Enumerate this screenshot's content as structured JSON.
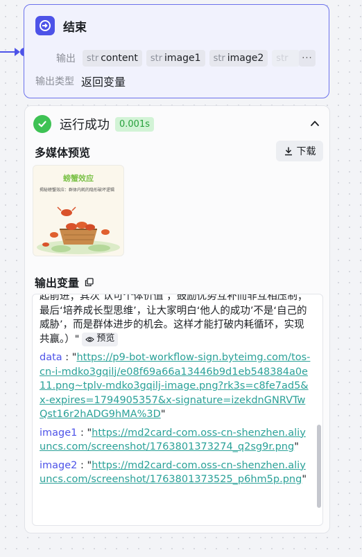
{
  "end_node": {
    "title": "结束",
    "output_label": "输出",
    "outputs": [
      {
        "type": "str",
        "name": "content"
      },
      {
        "type": "str",
        "name": "image1"
      },
      {
        "type": "str",
        "name": "image2"
      },
      {
        "type": "str",
        "name": ""
      }
    ],
    "more_label": "···",
    "output_type_label": "输出类型",
    "output_type_value": "返回变量"
  },
  "result": {
    "status_title": "运行成功",
    "elapsed": "0.001s",
    "media_preview_title": "多媒体预览",
    "download_label": "下载",
    "thumbnail": {
      "title": "螃蟹效应",
      "subtitle": "揭秘螃蟹效应：群体内耗的隐形破坏逻辑"
    },
    "output_vars_title": "输出变量",
    "content_text": "起前进；其次‘认可个体价值’，鼓励优势互补而非互相压制；最后‘培养成长型思维’，让大家明白‘他人的成功’不是‘自己的威胁’，而是群体进步的机会。这样才能打破内耗循环，实现共赢。）\"",
    "preview_label": "预览",
    "vars": [
      {
        "key": "data",
        "value": "https://p9-bot-workflow-sign.byteimg.com/tos-cn-i-mdko3gqilj/e08f69a66a13446b9d1eb548384a0e11.png~tplv-mdko3gqilj-image.png?rk3s=c8fe7ad5&x-expires=1794905357&x-signature=izekdnGNRVTwQst16r2hADG9hMA%3D"
      },
      {
        "key": "image1",
        "value": "https://md2card-com.oss-cn-shenzhen.aliyuncs.com/screenshot/1763801373274_q2sg9r.png"
      },
      {
        "key": "image2",
        "value": "https://md2card-com.oss-cn-shenzhen.aliyuncs.com/screenshot/1763801373525_p6hm5p.png"
      }
    ]
  },
  "colors": {
    "accent": "#4d53e8",
    "success": "#3ec254",
    "link": "#2aa198"
  }
}
